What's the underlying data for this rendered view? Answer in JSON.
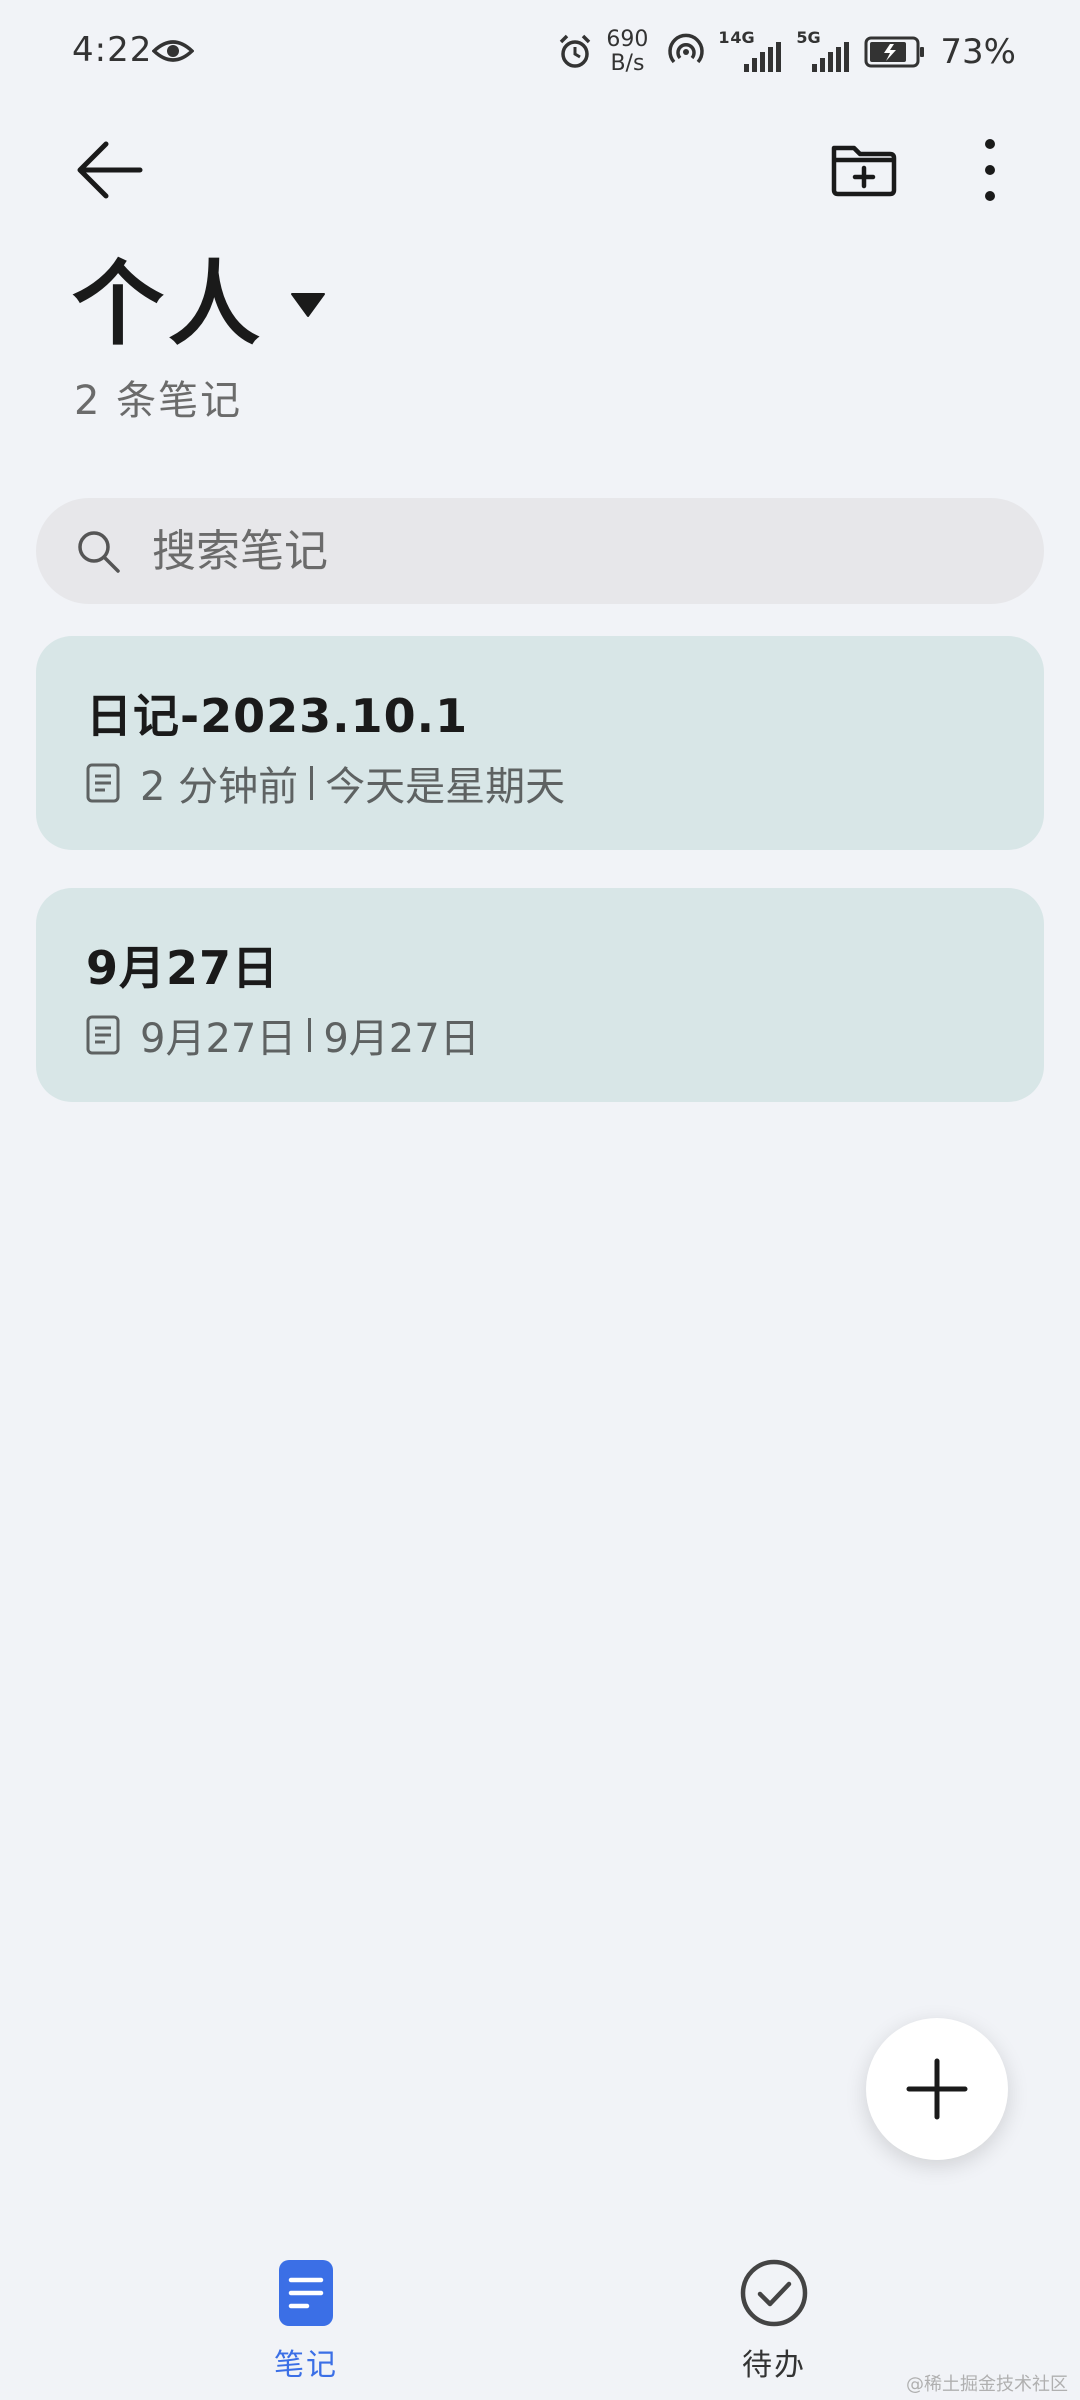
{
  "status_bar": {
    "time": "4:22",
    "net_speed_value": "690",
    "net_speed_unit": "B/s",
    "sim1_label": "1",
    "sim1_network": "4G",
    "sim2_network": "5G",
    "battery_percent": "73%"
  },
  "header": {
    "title": "个人",
    "note_count": "2 条笔记"
  },
  "search": {
    "placeholder": "搜索笔记"
  },
  "notes": [
    {
      "title": "日记-2023.10.1",
      "time": "2 分钟前",
      "preview": "今天是星期天"
    },
    {
      "title": "9月27日",
      "time": "9月27日",
      "preview": "9月27日"
    }
  ],
  "bottom_nav": {
    "notes_label": "笔记",
    "todo_label": "待办"
  },
  "watermark": "@稀土掘金技术社区",
  "colors": {
    "background": "#f1f3f7",
    "card": "#d8e6e7",
    "search_bg": "#e7e7ea",
    "accent": "#3b6fe6"
  }
}
